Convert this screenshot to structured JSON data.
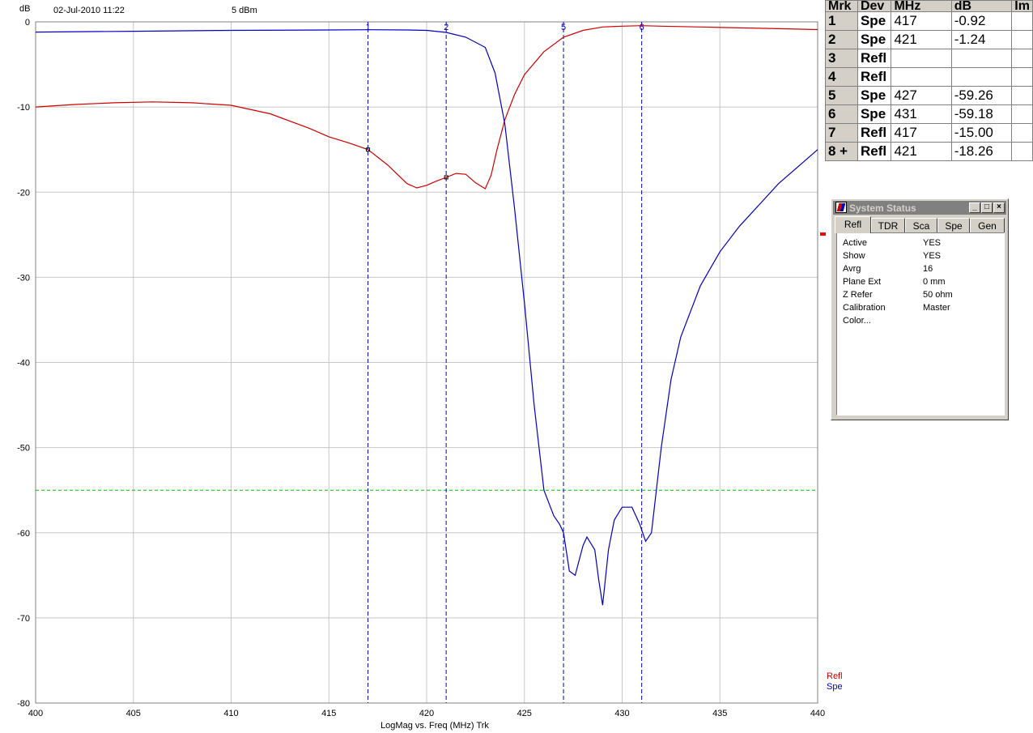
{
  "header": {
    "y_unit": "dB",
    "timestamp": "02-Jul-2010  11:22",
    "power": "5 dBm"
  },
  "chart_data": {
    "type": "line",
    "xlabel": "LogMag vs. Freq (MHz)  Trk",
    "ylabel": "dB",
    "xlim": [
      400,
      440
    ],
    "ylim": [
      -80,
      0
    ],
    "x_ticks": [
      400,
      405,
      410,
      415,
      420,
      425,
      430,
      435,
      440
    ],
    "y_ticks": [
      0,
      -10,
      -20,
      -30,
      -40,
      -50,
      -60,
      -70,
      -80
    ],
    "grid": true,
    "limit_line": {
      "y": -55,
      "color": "#00c000"
    },
    "legend": [
      "Refl",
      "Spe"
    ],
    "series": [
      {
        "name": "Refl",
        "color": "#d00000",
        "x": [
          400,
          402,
          404,
          406,
          408,
          410,
          412,
          414,
          415,
          416,
          417,
          418,
          419,
          419.5,
          420,
          420.5,
          421,
          421.5,
          422,
          422.5,
          423,
          423.3,
          423.6,
          424,
          424.5,
          425,
          426,
          427,
          428,
          429,
          430,
          431,
          432,
          434,
          436,
          438,
          440
        ],
        "y": [
          -10,
          -9.7,
          -9.5,
          -9.4,
          -9.5,
          -9.8,
          -10.8,
          -12.5,
          -13.5,
          -14.2,
          -15.0,
          -16.8,
          -19.0,
          -19.5,
          -19.2,
          -18.7,
          -18.26,
          -17.8,
          -17.9,
          -18.9,
          -19.6,
          -18.0,
          -15.0,
          -11.5,
          -8.5,
          -6.2,
          -3.5,
          -1.8,
          -1.0,
          -0.6,
          -0.5,
          -0.45,
          -0.5,
          -0.6,
          -0.7,
          -0.8,
          -0.9
        ]
      },
      {
        "name": "Spe",
        "color": "#0000c0",
        "x": [
          400,
          405,
          410,
          415,
          417,
          419,
          420,
          421,
          422,
          423,
          423.5,
          424,
          424.5,
          425,
          425.5,
          426,
          426.5,
          426.8,
          427,
          427.3,
          427.6,
          428,
          428.2,
          428.6,
          428.8,
          429,
          429.3,
          429.6,
          430,
          430.5,
          430.9,
          431.2,
          431.5,
          432,
          432.5,
          433,
          434,
          435,
          436,
          437,
          438,
          439,
          440
        ],
        "y": [
          -1.2,
          -1.1,
          -1.0,
          -0.95,
          -0.92,
          -0.95,
          -1.0,
          -1.24,
          -1.8,
          -3.0,
          -6.0,
          -12.0,
          -22.0,
          -33.0,
          -45.0,
          -55.0,
          -58.0,
          -59.0,
          -60.0,
          -64.5,
          -65.0,
          -61.5,
          -60.5,
          -62.0,
          -65.5,
          -68.5,
          -62.0,
          -58.5,
          -57.0,
          -57.0,
          -59.0,
          -61.0,
          -60.0,
          -50.0,
          -42.0,
          -37.0,
          -31.0,
          -27.0,
          -24.0,
          -21.5,
          -19.0,
          -17.0,
          -15.0
        ]
      }
    ],
    "markers": [
      {
        "label": "1",
        "x": 417
      },
      {
        "label": "2",
        "x": 421
      },
      {
        "label": "5",
        "x": 427
      },
      {
        "label": "6",
        "x": 431
      }
    ]
  },
  "marker_table": {
    "headers": [
      "Mrk",
      "Dev",
      "MHz",
      "dB",
      "Im"
    ],
    "rows": [
      {
        "mrk": "1",
        "dev": "Spe",
        "mhz": "417",
        "db": "-0.92"
      },
      {
        "mrk": "2",
        "dev": "Spe",
        "mhz": "421",
        "db": "-1.24"
      },
      {
        "mrk": "3",
        "dev": "Refl",
        "mhz": "",
        "db": ""
      },
      {
        "mrk": "4",
        "dev": "Refl",
        "mhz": "",
        "db": ""
      },
      {
        "mrk": "5",
        "dev": "Spe",
        "mhz": "427",
        "db": "-59.26"
      },
      {
        "mrk": "6",
        "dev": "Spe",
        "mhz": "431",
        "db": "-59.18"
      },
      {
        "mrk": "7",
        "dev": "Refl",
        "mhz": "417",
        "db": "-15.00"
      },
      {
        "mrk": "8 +",
        "dev": "Refl",
        "mhz": "421",
        "db": "-18.26"
      }
    ]
  },
  "status_window": {
    "title": "System Status",
    "tabs": [
      "Refl",
      "TDR",
      "Sca",
      "Spe",
      "Gen"
    ],
    "active_tab": "Refl",
    "rows": [
      {
        "label": "Active",
        "value": "YES"
      },
      {
        "label": "Show",
        "value": "YES"
      },
      {
        "label": "Avrg",
        "value": "16"
      },
      {
        "label": "Plane Ext",
        "value": "0 mm"
      },
      {
        "label": "Z Refer",
        "value": "50 ohm"
      },
      {
        "label": "Calibration",
        "value": "Master"
      },
      {
        "label": "Color...",
        "value": ""
      }
    ]
  }
}
